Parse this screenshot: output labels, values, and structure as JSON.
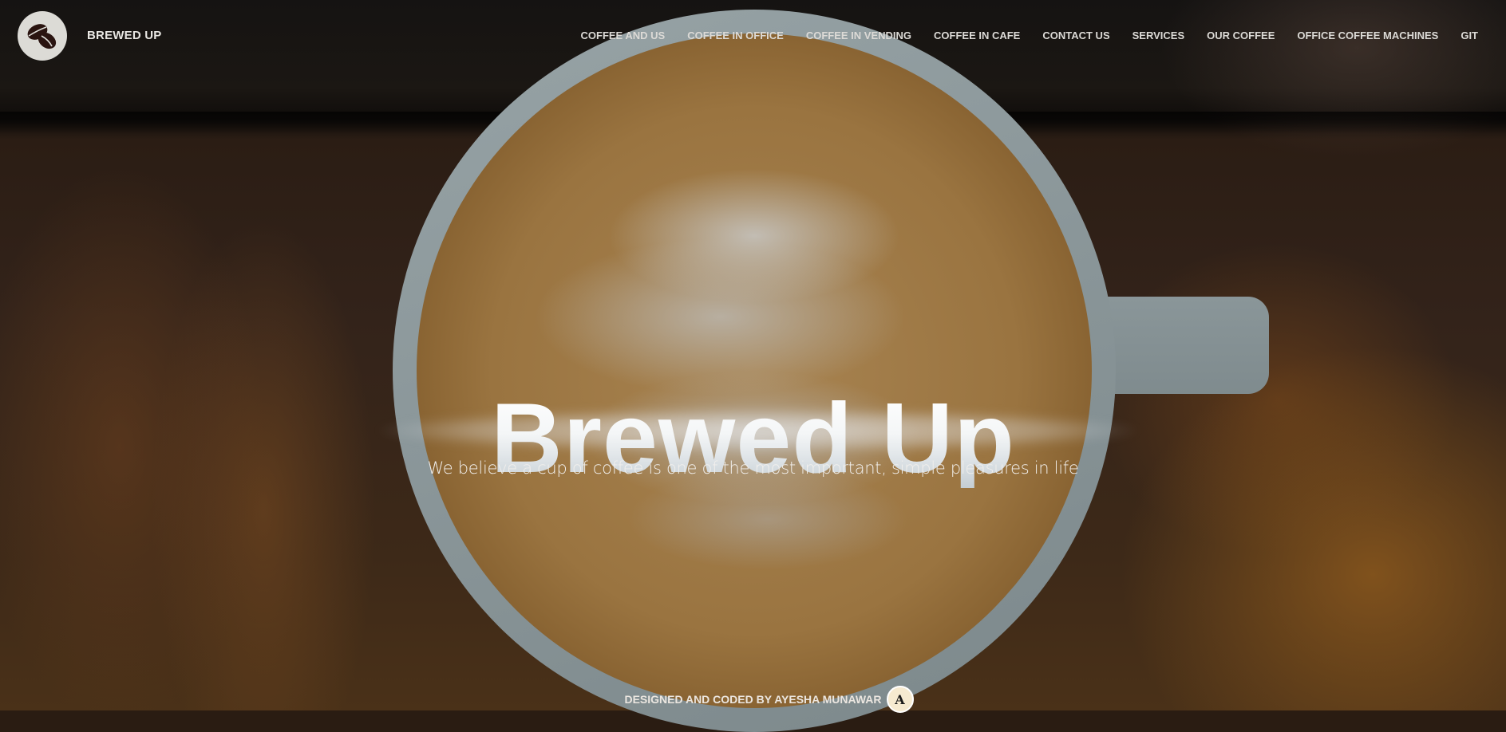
{
  "header": {
    "brand": "BREWED UP",
    "logo_icon": "coffee-beans-icon",
    "nav": [
      {
        "label": "COFFEE AND US"
      },
      {
        "label": "COFFEE IN OFFICE"
      },
      {
        "label": "COFFEE IN VENDING"
      },
      {
        "label": "COFFEE IN CAFE"
      },
      {
        "label": "CONTACT US"
      },
      {
        "label": "SERVICES"
      },
      {
        "label": "OUR COFFEE"
      },
      {
        "label": "OFFICE COFFEE MACHINES"
      },
      {
        "label": "GIT"
      }
    ]
  },
  "hero": {
    "title": "Brewed Up",
    "subtitle": "We believe a cup of coffee is one of the most important, simple pleasures in life"
  },
  "footer": {
    "credit": "DESIGNED AND CODED BY AYESHA MUNAWAR",
    "avatar_letter": "A"
  },
  "colors": {
    "nav_text": "#dcdad6",
    "logo_bg": "#dcdbd6",
    "bean": "#2a1410"
  }
}
